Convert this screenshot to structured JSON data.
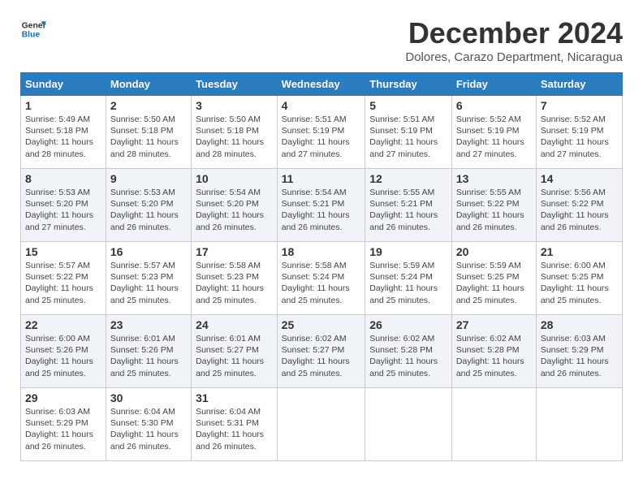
{
  "header": {
    "logo_general": "General",
    "logo_blue": "Blue",
    "month_year": "December 2024",
    "location": "Dolores, Carazo Department, Nicaragua"
  },
  "days_of_week": [
    "Sunday",
    "Monday",
    "Tuesday",
    "Wednesday",
    "Thursday",
    "Friday",
    "Saturday"
  ],
  "weeks": [
    [
      {
        "day": "1",
        "sunrise": "5:49 AM",
        "sunset": "5:18 PM",
        "daylight": "11 hours and 28 minutes."
      },
      {
        "day": "2",
        "sunrise": "5:50 AM",
        "sunset": "5:18 PM",
        "daylight": "11 hours and 28 minutes."
      },
      {
        "day": "3",
        "sunrise": "5:50 AM",
        "sunset": "5:18 PM",
        "daylight": "11 hours and 28 minutes."
      },
      {
        "day": "4",
        "sunrise": "5:51 AM",
        "sunset": "5:19 PM",
        "daylight": "11 hours and 27 minutes."
      },
      {
        "day": "5",
        "sunrise": "5:51 AM",
        "sunset": "5:19 PM",
        "daylight": "11 hours and 27 minutes."
      },
      {
        "day": "6",
        "sunrise": "5:52 AM",
        "sunset": "5:19 PM",
        "daylight": "11 hours and 27 minutes."
      },
      {
        "day": "7",
        "sunrise": "5:52 AM",
        "sunset": "5:19 PM",
        "daylight": "11 hours and 27 minutes."
      }
    ],
    [
      {
        "day": "8",
        "sunrise": "5:53 AM",
        "sunset": "5:20 PM",
        "daylight": "11 hours and 27 minutes."
      },
      {
        "day": "9",
        "sunrise": "5:53 AM",
        "sunset": "5:20 PM",
        "daylight": "11 hours and 26 minutes."
      },
      {
        "day": "10",
        "sunrise": "5:54 AM",
        "sunset": "5:20 PM",
        "daylight": "11 hours and 26 minutes."
      },
      {
        "day": "11",
        "sunrise": "5:54 AM",
        "sunset": "5:21 PM",
        "daylight": "11 hours and 26 minutes."
      },
      {
        "day": "12",
        "sunrise": "5:55 AM",
        "sunset": "5:21 PM",
        "daylight": "11 hours and 26 minutes."
      },
      {
        "day": "13",
        "sunrise": "5:55 AM",
        "sunset": "5:22 PM",
        "daylight": "11 hours and 26 minutes."
      },
      {
        "day": "14",
        "sunrise": "5:56 AM",
        "sunset": "5:22 PM",
        "daylight": "11 hours and 26 minutes."
      }
    ],
    [
      {
        "day": "15",
        "sunrise": "5:57 AM",
        "sunset": "5:22 PM",
        "daylight": "11 hours and 25 minutes."
      },
      {
        "day": "16",
        "sunrise": "5:57 AM",
        "sunset": "5:23 PM",
        "daylight": "11 hours and 25 minutes."
      },
      {
        "day": "17",
        "sunrise": "5:58 AM",
        "sunset": "5:23 PM",
        "daylight": "11 hours and 25 minutes."
      },
      {
        "day": "18",
        "sunrise": "5:58 AM",
        "sunset": "5:24 PM",
        "daylight": "11 hours and 25 minutes."
      },
      {
        "day": "19",
        "sunrise": "5:59 AM",
        "sunset": "5:24 PM",
        "daylight": "11 hours and 25 minutes."
      },
      {
        "day": "20",
        "sunrise": "5:59 AM",
        "sunset": "5:25 PM",
        "daylight": "11 hours and 25 minutes."
      },
      {
        "day": "21",
        "sunrise": "6:00 AM",
        "sunset": "5:25 PM",
        "daylight": "11 hours and 25 minutes."
      }
    ],
    [
      {
        "day": "22",
        "sunrise": "6:00 AM",
        "sunset": "5:26 PM",
        "daylight": "11 hours and 25 minutes."
      },
      {
        "day": "23",
        "sunrise": "6:01 AM",
        "sunset": "5:26 PM",
        "daylight": "11 hours and 25 minutes."
      },
      {
        "day": "24",
        "sunrise": "6:01 AM",
        "sunset": "5:27 PM",
        "daylight": "11 hours and 25 minutes."
      },
      {
        "day": "25",
        "sunrise": "6:02 AM",
        "sunset": "5:27 PM",
        "daylight": "11 hours and 25 minutes."
      },
      {
        "day": "26",
        "sunrise": "6:02 AM",
        "sunset": "5:28 PM",
        "daylight": "11 hours and 25 minutes."
      },
      {
        "day": "27",
        "sunrise": "6:02 AM",
        "sunset": "5:28 PM",
        "daylight": "11 hours and 25 minutes."
      },
      {
        "day": "28",
        "sunrise": "6:03 AM",
        "sunset": "5:29 PM",
        "daylight": "11 hours and 26 minutes."
      }
    ],
    [
      {
        "day": "29",
        "sunrise": "6:03 AM",
        "sunset": "5:29 PM",
        "daylight": "11 hours and 26 minutes."
      },
      {
        "day": "30",
        "sunrise": "6:04 AM",
        "sunset": "5:30 PM",
        "daylight": "11 hours and 26 minutes."
      },
      {
        "day": "31",
        "sunrise": "6:04 AM",
        "sunset": "5:31 PM",
        "daylight": "11 hours and 26 minutes."
      },
      null,
      null,
      null,
      null
    ]
  ]
}
